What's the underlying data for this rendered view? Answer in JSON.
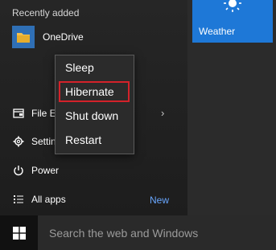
{
  "start_menu": {
    "recently_added_title": "Recently added",
    "recent_apps": [
      {
        "label": "OneDrive",
        "icon": "onedrive-folder-icon"
      }
    ],
    "nav": {
      "file_explorer": {
        "label": "File Explorer",
        "icon": "file-explorer-icon",
        "has_submenu": true
      },
      "settings": {
        "label": "Settings",
        "icon": "gear-icon"
      },
      "power": {
        "label": "Power",
        "icon": "power-icon"
      },
      "all_apps": {
        "label": "All apps",
        "icon": "list-icon",
        "badge": "New"
      }
    },
    "tiles": [
      {
        "label": "Weather",
        "icon": "sun-icon",
        "color": "#1e78d7"
      }
    ]
  },
  "power_menu": {
    "items": [
      {
        "label": "Sleep"
      },
      {
        "label": "Hibernate",
        "highlighted": true
      },
      {
        "label": "Shut down"
      },
      {
        "label": "Restart"
      }
    ],
    "highlight_color": "#d4222a"
  },
  "taskbar": {
    "start_icon": "windows-logo-icon",
    "search": {
      "placeholder": "Search the web and Windows",
      "value": ""
    }
  }
}
